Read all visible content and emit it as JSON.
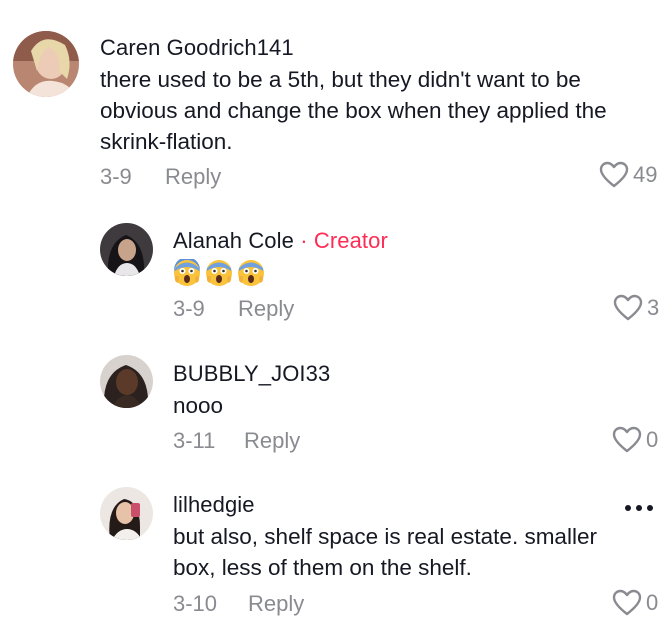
{
  "comments": [
    {
      "username": "Caren Goodrich141",
      "text_lines": [
        "there used to be a 5th, but they didn't want to be",
        "obvious and change the box when they applied the",
        "skrink-flation."
      ],
      "date": "3-9",
      "reply_label": "Reply",
      "likes": "49"
    }
  ],
  "replies": [
    {
      "username": "Alanah Cole",
      "creator_tag": "· Creator",
      "emojis": [
        "face-screaming-in-fear",
        "face-screaming-in-fear",
        "face-screaming-in-fear"
      ],
      "date": "3-9",
      "reply_label": "Reply",
      "likes": "3"
    },
    {
      "username": "BUBBLY_JOI33",
      "text": "nooo",
      "date": "3-11",
      "reply_label": "Reply",
      "likes": "0"
    },
    {
      "username": "lilhedgie",
      "text_lines": [
        "but also, shelf space is real estate. smaller",
        "box, less of them on the shelf."
      ],
      "date": "3-10",
      "reply_label": "Reply",
      "likes": "0"
    }
  ],
  "colors": {
    "creator_accent": "#fe2c55",
    "meta_gray": "#8a8b91",
    "text": "#161823"
  },
  "icons": {
    "like": "heart-outline-icon",
    "more": "more-horizontal-icon"
  }
}
